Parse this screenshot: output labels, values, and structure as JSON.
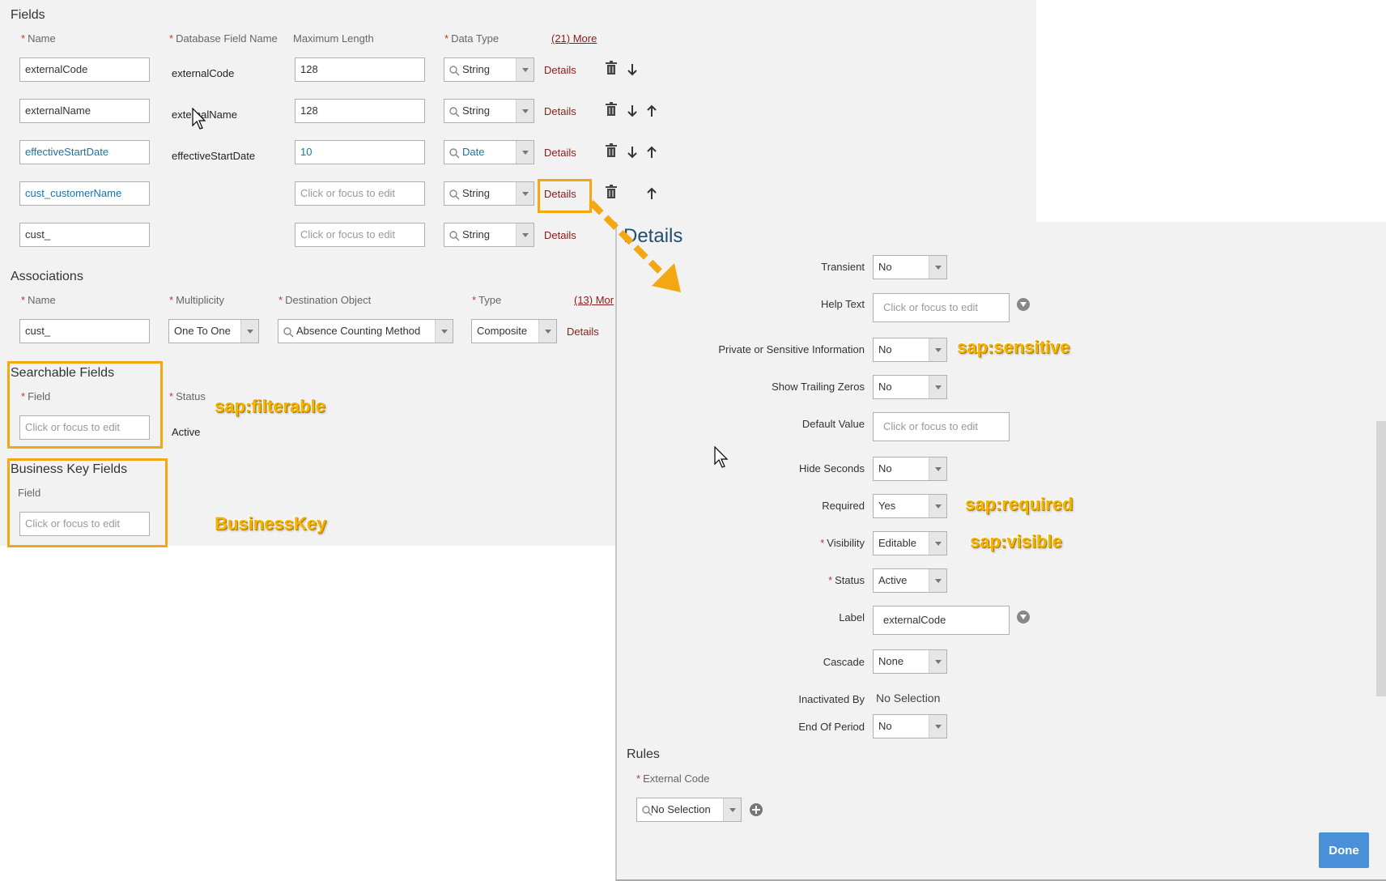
{
  "fields_section": {
    "title": "Fields",
    "columns": {
      "name": "Name",
      "db_field": "Database Field Name",
      "max_length": "Maximum Length",
      "data_type": "Data Type",
      "more": "(21) More"
    },
    "rows": [
      {
        "name": "externalCode",
        "db": "externalCode",
        "max": "128",
        "type": "String",
        "details": "Details"
      },
      {
        "name": "externalName",
        "db": "externalName",
        "max": "128",
        "type": "String",
        "details": "Details"
      },
      {
        "name": "effectiveStartDate",
        "db": "effectiveStartDate",
        "max": "10",
        "type": "Date",
        "details": "Details"
      },
      {
        "name": "cust_customerName",
        "db": "",
        "max": "Click or focus to edit",
        "type": "String",
        "details": "Details"
      },
      {
        "name": "cust_",
        "db": "",
        "max": "Click or focus to edit",
        "type": "String",
        "details": "Details"
      }
    ]
  },
  "associations": {
    "title": "Associations",
    "columns": {
      "name": "Name",
      "multiplicity": "Multiplicity",
      "destination": "Destination Object",
      "type": "Type",
      "more": "(13) Mor"
    },
    "row": {
      "name": "cust_",
      "multiplicity": "One To One",
      "destination": "Absence Counting Method",
      "type": "Composite",
      "details": "Details"
    }
  },
  "searchable": {
    "title": "Searchable Fields",
    "field_label": "Field",
    "status_label": "Status",
    "field_placeholder": "Click or focus to edit",
    "status_value": "Active"
  },
  "business_key": {
    "title": "Business Key Fields",
    "field_label": "Field",
    "field_placeholder": "Click or focus to edit"
  },
  "annotations": {
    "filterable": "sap:filterable",
    "business_key": "BusinessKey",
    "sensitive": "sap:sensitive",
    "required": "sap:required",
    "visible": "sap:visible"
  },
  "details_panel": {
    "title": "Details",
    "transient": {
      "label": "Transient",
      "value": "No"
    },
    "help_text": {
      "label": "Help Text",
      "placeholder": "Click or focus to edit"
    },
    "private": {
      "label": "Private or Sensitive Information",
      "value": "No"
    },
    "trailing_zeros": {
      "label": "Show Trailing Zeros",
      "value": "No"
    },
    "default_value": {
      "label": "Default Value",
      "placeholder": "Click or focus to edit"
    },
    "hide_seconds": {
      "label": "Hide Seconds",
      "value": "No"
    },
    "required": {
      "label": "Required",
      "value": "Yes"
    },
    "visibility": {
      "label": "Visibility",
      "value": "Editable"
    },
    "status": {
      "label": "Status",
      "value": "Active"
    },
    "label": {
      "label": "Label",
      "value": "externalCode"
    },
    "cascade": {
      "label": "Cascade",
      "value": "None"
    },
    "inactivated_by": {
      "label": "Inactivated By",
      "value": "No Selection"
    },
    "end_of_period": {
      "label": "End Of Period",
      "value": "No"
    },
    "rules": {
      "title": "Rules",
      "external_code_label": "External Code",
      "external_code_value": "No Selection"
    },
    "done": "Done"
  },
  "colors": {
    "accent_highlight": "#f3a712",
    "details_link": "#8b1a1a",
    "done_button": "#4a90d9",
    "link_text": "#1a73a8"
  }
}
